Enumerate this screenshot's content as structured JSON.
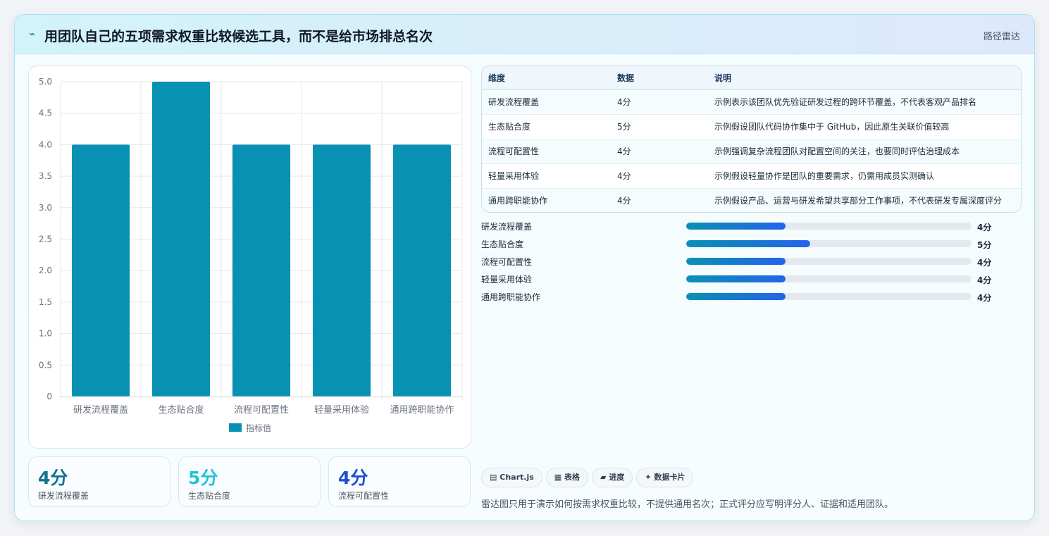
{
  "header": {
    "icon": "pulse-icon",
    "title": "用团队自己的五项需求权重比较候选工具，而不是给市场排总名次",
    "tag": "路径雷达"
  },
  "chart_data": {
    "type": "bar",
    "categories": [
      "研发流程覆盖",
      "生态贴合度",
      "流程可配置性",
      "轻量采用体验",
      "通用跨职能协作"
    ],
    "series": [
      {
        "name": "指标值",
        "values": [
          4,
          5,
          4,
          4,
          4
        ]
      }
    ],
    "ylim": [
      0,
      5
    ],
    "yticks": [
      "0",
      "0.5",
      "1.0",
      "1.5",
      "2.0",
      "2.5",
      "3.0",
      "3.5",
      "4.0",
      "4.5",
      "5.0"
    ],
    "grid": true,
    "legend": "bottom",
    "bar_color": "#0891b2"
  },
  "kpis": [
    {
      "value": "4分",
      "label": "研发流程覆盖",
      "color": "#0e7490"
    },
    {
      "value": "5分",
      "label": "生态贴合度",
      "color": "#22c3d8"
    },
    {
      "value": "4分",
      "label": "流程可配置性",
      "color": "#1d4ed8"
    }
  ],
  "table": {
    "headers": [
      "维度",
      "数据",
      "说明"
    ],
    "rows": [
      [
        "研发流程覆盖",
        "4分",
        "示例表示该团队优先验证研发过程的跨环节覆盖，不代表客观产品排名"
      ],
      [
        "生态贴合度",
        "5分",
        "示例假设团队代码协作集中于 GitHub，因此原生关联价值较高"
      ],
      [
        "流程可配置性",
        "4分",
        "示例强调复杂流程团队对配置空间的关注，也要同时评估治理成本"
      ],
      [
        "轻量采用体验",
        "4分",
        "示例假设轻量协作是团队的重要需求，仍需用成员实测确认"
      ],
      [
        "通用跨职能协作",
        "4分",
        "示例假设产品、运营与研发希望共享部分工作事项，不代表研发专属深度评分"
      ]
    ]
  },
  "progress": [
    {
      "label": "研发流程覆盖",
      "value": "4分",
      "fraction": 0.348
    },
    {
      "label": "生态贴合度",
      "value": "5分",
      "fraction": 0.435
    },
    {
      "label": "流程可配置性",
      "value": "4分",
      "fraction": 0.348
    },
    {
      "label": "轻量采用体验",
      "value": "4分",
      "fraction": 0.348
    },
    {
      "label": "通用跨职能协作",
      "value": "4分",
      "fraction": 0.348
    }
  ],
  "chips": [
    {
      "icon": "chart-icon",
      "glyph": "▤",
      "label": "Chart.js"
    },
    {
      "icon": "table-icon",
      "glyph": "▦",
      "label": "表格"
    },
    {
      "icon": "progress-icon",
      "glyph": "▰",
      "label": "进度"
    },
    {
      "icon": "sparkle-icon",
      "glyph": "✦",
      "label": "数据卡片"
    }
  ],
  "note": "雷达图只用于演示如何按需求权重比较，不提供通用名次；正式评分应写明评分人、证据和适用团队。"
}
